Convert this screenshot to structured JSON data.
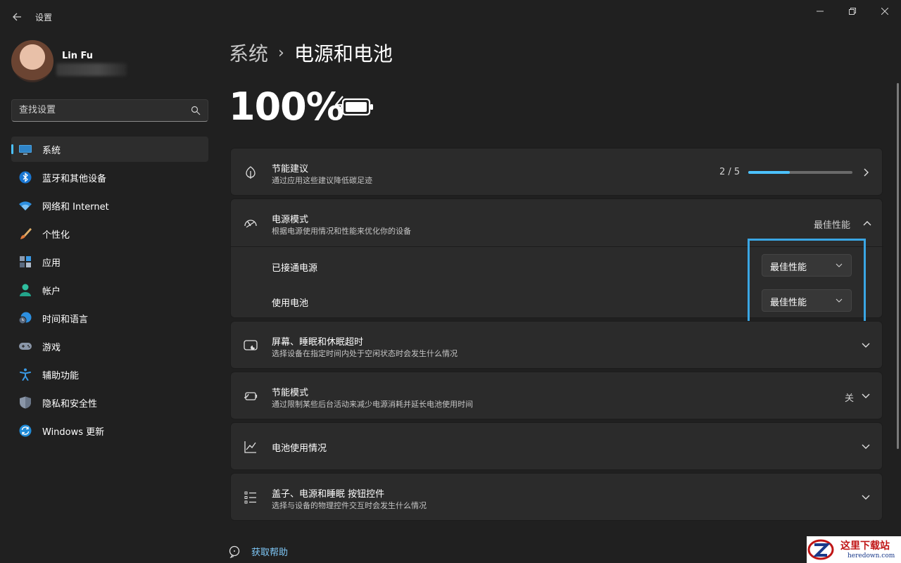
{
  "window": {
    "title": "设置"
  },
  "user": {
    "name": "Lin Fu"
  },
  "search": {
    "placeholder": "查找设置"
  },
  "sidebar": {
    "items": [
      {
        "label": "系统",
        "icon": "monitor-icon",
        "active": true
      },
      {
        "label": "蓝牙和其他设备",
        "icon": "bluetooth-icon"
      },
      {
        "label": "网络和 Internet",
        "icon": "wifi-icon"
      },
      {
        "label": "个性化",
        "icon": "brush-icon"
      },
      {
        "label": "应用",
        "icon": "apps-icon"
      },
      {
        "label": "帐户",
        "icon": "account-icon"
      },
      {
        "label": "时间和语言",
        "icon": "globe-clock-icon"
      },
      {
        "label": "游戏",
        "icon": "gamepad-icon"
      },
      {
        "label": "辅助功能",
        "icon": "accessibility-icon"
      },
      {
        "label": "隐私和安全性",
        "icon": "shield-icon"
      },
      {
        "label": "Windows 更新",
        "icon": "update-icon"
      }
    ]
  },
  "breadcrumb": {
    "parent": "系统",
    "separator": "›",
    "current": "电源和电池"
  },
  "battery": {
    "percent": "100%"
  },
  "cards": {
    "energy": {
      "title": "节能建议",
      "subtitle": "通过应用这些建议降低碳足迹",
      "progress_text": "2 / 5",
      "progress_fraction": 0.4
    },
    "power_mode": {
      "title": "电源模式",
      "subtitle": "根据电源使用情况和性能来优化你的设备",
      "value": "最佳性能",
      "plugged_label": "已接通电源",
      "plugged_value": "最佳性能",
      "battery_label": "使用电池",
      "battery_value": "最佳性能"
    },
    "screen_sleep": {
      "title": "屏幕、睡眠和休眠超时",
      "subtitle": "选择设备在指定时间内处于空闲状态时会发生什么情况"
    },
    "saver": {
      "title": "节能模式",
      "subtitle": "通过限制某些后台活动来减少电源消耗并延长电池使用时间",
      "value": "关"
    },
    "usage": {
      "title": "电池使用情况"
    },
    "lid": {
      "title": "盖子、电源和睡眠 按钮控件",
      "subtitle": "选择与设备的物理控件交互时会发生什么情况"
    }
  },
  "help": {
    "label": "获取帮助"
  },
  "watermark": {
    "text": "这里下载站",
    "sub": "heredown.com"
  },
  "colors": {
    "accent": "#4cc2ff",
    "highlight": "#3aa6e4",
    "background": "#202020",
    "card": "#2b2b2b"
  }
}
